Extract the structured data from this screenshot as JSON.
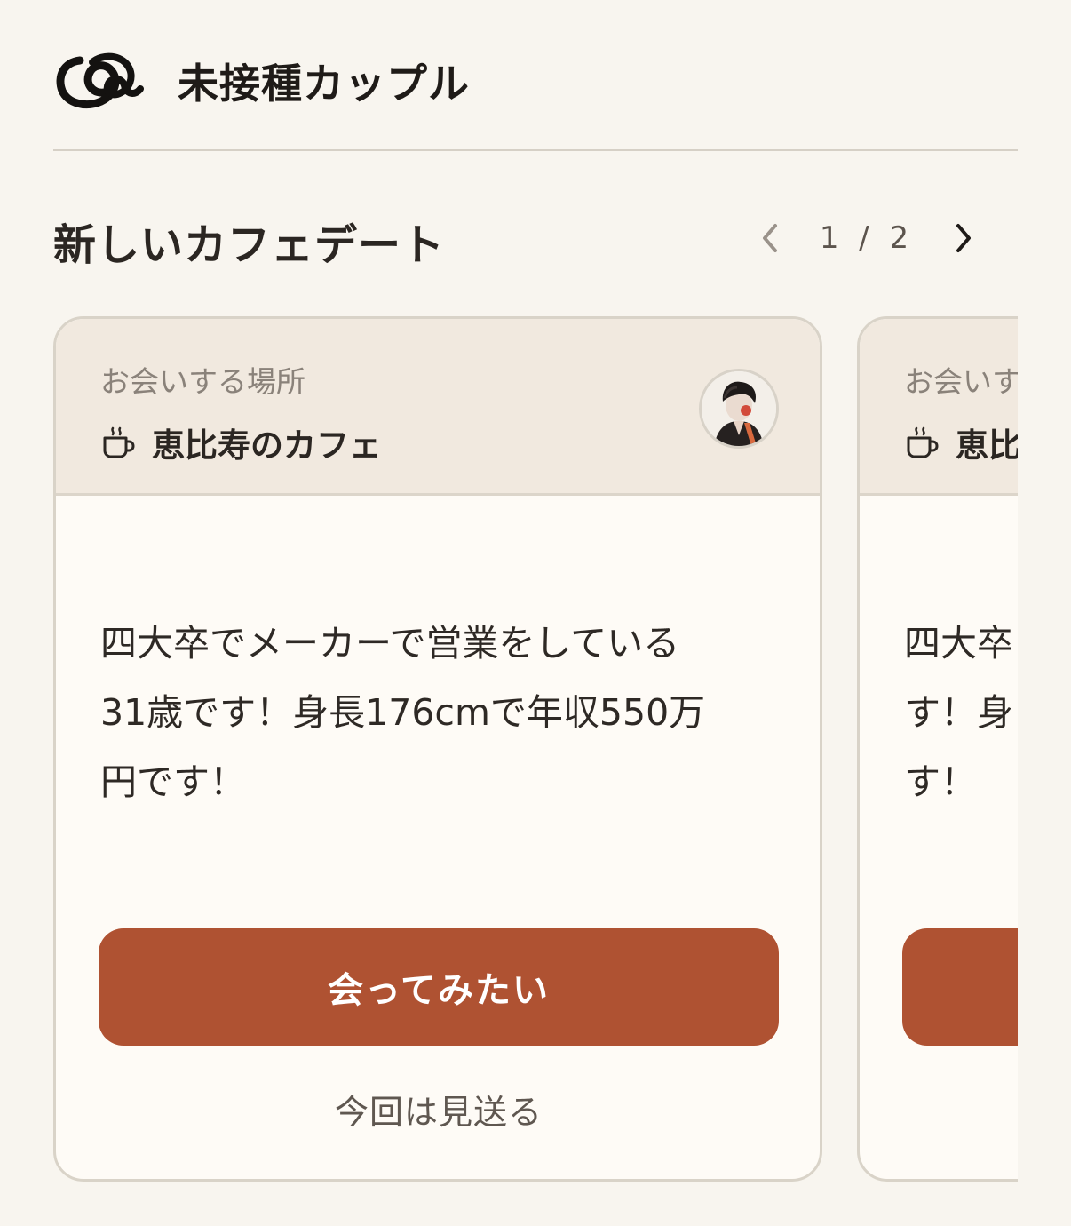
{
  "app": {
    "title": "未接種カップル",
    "logo_icon": "interlocking-rings-logo-icon"
  },
  "section": {
    "title": "新しいカフェデート",
    "pager": {
      "count": "1 / 2",
      "prev_icon": "chevron-left-icon",
      "next_icon": "chevron-right-icon"
    }
  },
  "cards": [
    {
      "place_label": "お会いする場所",
      "place_icon": "coffee-cup-icon",
      "place_name": "恵比寿のカフェ",
      "message": "四大卒でメーカーで営業をしている\n31歳です！身長176cmで年収550万\n円です！",
      "meet_label": "会ってみたい",
      "skip_label": "今回は見送る"
    },
    {
      "place_label": "お会いす",
      "place_icon": "coffee-cup-icon",
      "place_name": "恵比",
      "message": "四大卒\nす！身\nす！"
    }
  ],
  "colors": {
    "accent": "#af5232",
    "background": "#f8f5ef",
    "card_header": "#f1e9df"
  }
}
